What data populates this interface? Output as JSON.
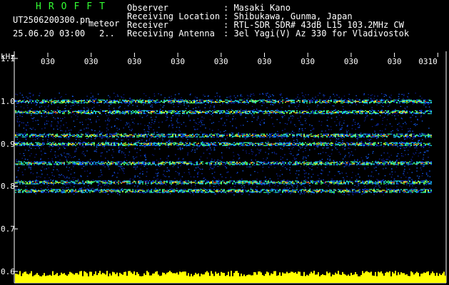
{
  "header": {
    "brand": "HROFFT",
    "filename": "UT2506200300.pn",
    "mode": "meteor",
    "datetime": "25.06.20 03:00",
    "index": "2..",
    "fields": [
      {
        "label": "Observer",
        "value": ": Masaki Kano"
      },
      {
        "label": "Receiving Location",
        "value": ": Shibukawa, Gunma, Japan"
      },
      {
        "label": "Receiver",
        "value": ": RTL-SDR SDR# 43dB L15 103.2MHz CW"
      },
      {
        "label": "Receiving Antenna",
        "value": ": 3el Yagi(V) Az 330 for Vladivostok"
      }
    ]
  },
  "chart_data": {
    "type": "heatmap",
    "ylabel": "kHz",
    "y_ticks": [
      "1.1",
      "1.0",
      "0.9",
      "0.8",
      "0.7",
      "0.6"
    ],
    "y_tick_values": [
      1.1,
      1.0,
      0.9,
      0.8,
      0.7,
      0.6
    ],
    "ylim": [
      0.6,
      1.1
    ],
    "x_ticks": [
      "030",
      "030",
      "030",
      "030",
      "030",
      "030",
      "030",
      "030",
      "030",
      "0310"
    ],
    "bands_khz": [
      1.0,
      0.975,
      0.92,
      0.9,
      0.855,
      0.81,
      0.79
    ],
    "signal_range_khz": [
      0.78,
      1.02
    ],
    "colors": {
      "bg": "#000000",
      "text": "#ffffff",
      "accent": "#33ff33",
      "bar": "#ffff00"
    }
  }
}
